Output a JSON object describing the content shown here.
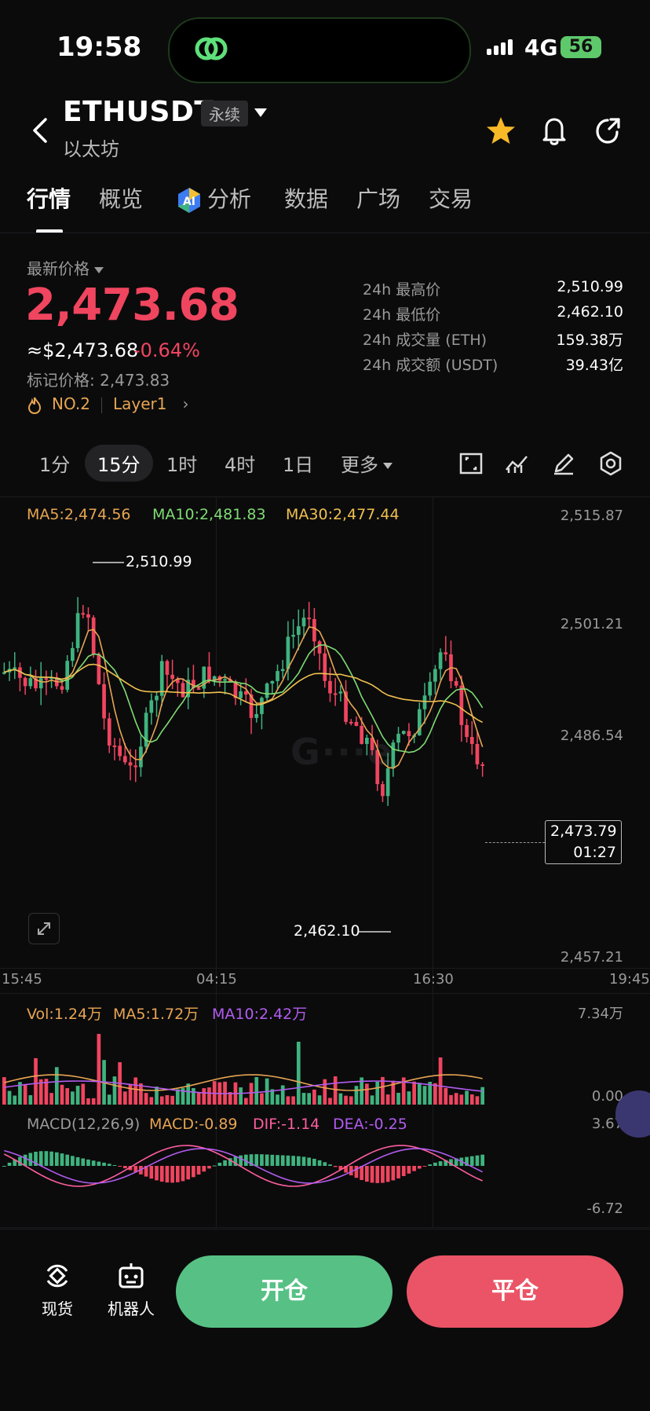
{
  "status": {
    "time": "19:58",
    "network": "4G",
    "battery": "56"
  },
  "header": {
    "symbol": "ETHUSDT",
    "contract_tag": "永续",
    "subtitle": "以太坊"
  },
  "tabs": [
    {
      "label": "行情"
    },
    {
      "label": "概览"
    },
    {
      "label": "分析"
    },
    {
      "label": "数据"
    },
    {
      "label": "广场"
    },
    {
      "label": "交易"
    }
  ],
  "price": {
    "label": "最新价格",
    "last": "2,473.68",
    "usd": "≈$2,473.68",
    "change": "-0.64%",
    "mark": "标记价格: 2,473.83",
    "rank": "NO.2",
    "sector": "Layer1"
  },
  "stats": [
    {
      "label": "24h 最高价",
      "value": "2,510.99"
    },
    {
      "label": "24h 最低价",
      "value": "2,462.10"
    },
    {
      "label": "24h 成交量 (ETH)",
      "value": "159.38万"
    },
    {
      "label": "24h 成交额 (USDT)",
      "value": "39.43亿"
    }
  ],
  "intervals": [
    "1分",
    "15分",
    "1时",
    "4时",
    "1日",
    "更多"
  ],
  "active_interval": "15分",
  "colors": {
    "up": "#3fb37f",
    "down": "#f0455f",
    "ma5": "#e8a552",
    "ma10": "#7fdc72",
    "ma30": "#f0c04f",
    "dea": "#b25cf0",
    "dif": "#ff5e9e"
  },
  "main_chart": {
    "ma_labels": {
      "ma5": "MA5:2,474.56",
      "ma10": "MA10:2,481.83",
      "ma30": "MA30:2,477.44"
    },
    "y_ticks": [
      "2,515.87",
      "2,501.21",
      "2,486.54",
      "2,457.21"
    ],
    "x_ticks": [
      "15:45",
      "04:15",
      "16:30",
      "19:45"
    ],
    "high_label": "2,510.99",
    "low_label": "2,462.10",
    "current_price": "2,473.79",
    "countdown": "01:27"
  },
  "volume": {
    "vol": "Vol:1.24万",
    "ma5": "MA5:1.72万",
    "ma10": "MA10:2.42万",
    "y_max": "7.34万",
    "y_min": "0.00"
  },
  "macd": {
    "title": "MACD(12,26,9)",
    "macd": "MACD:-0.89",
    "dif": "DIF:-1.14",
    "dea": "DEA:-0.25",
    "y_max": "3.67",
    "y_min": "-6.72"
  },
  "bottom": {
    "spot": "现货",
    "bot": "机器人",
    "open": "开仓",
    "close": "平仓"
  }
}
